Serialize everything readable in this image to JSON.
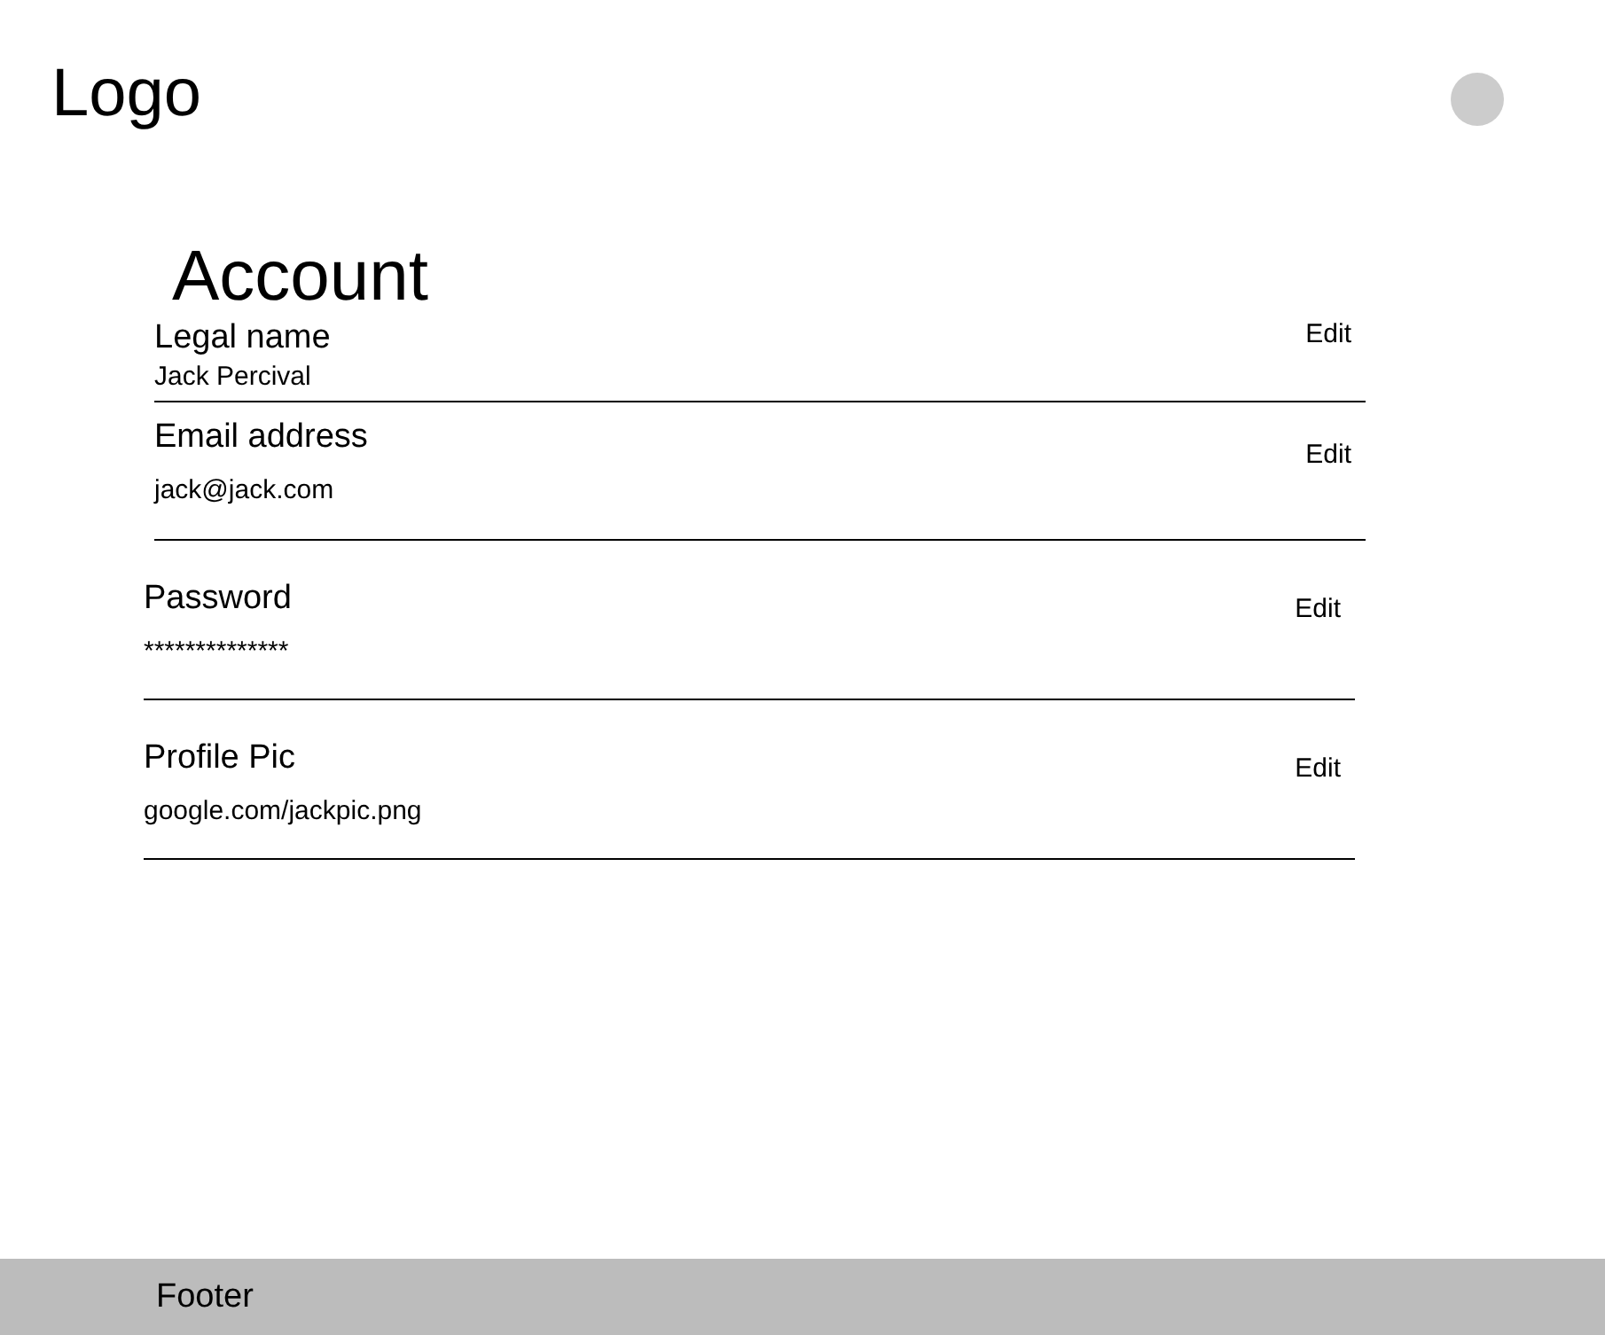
{
  "header": {
    "logo": "Logo"
  },
  "account": {
    "title": "Account",
    "fields": [
      {
        "label": "Legal name",
        "value": "Jack Percival",
        "action": "Edit"
      },
      {
        "label": "Email address",
        "value": "jack@jack.com",
        "action": "Edit"
      },
      {
        "label": "Password",
        "value": "**************",
        "action": "Edit"
      },
      {
        "label": "Profile Pic",
        "value": "google.com/jackpic.png",
        "action": "Edit"
      }
    ]
  },
  "footer": {
    "text": "Footer"
  }
}
